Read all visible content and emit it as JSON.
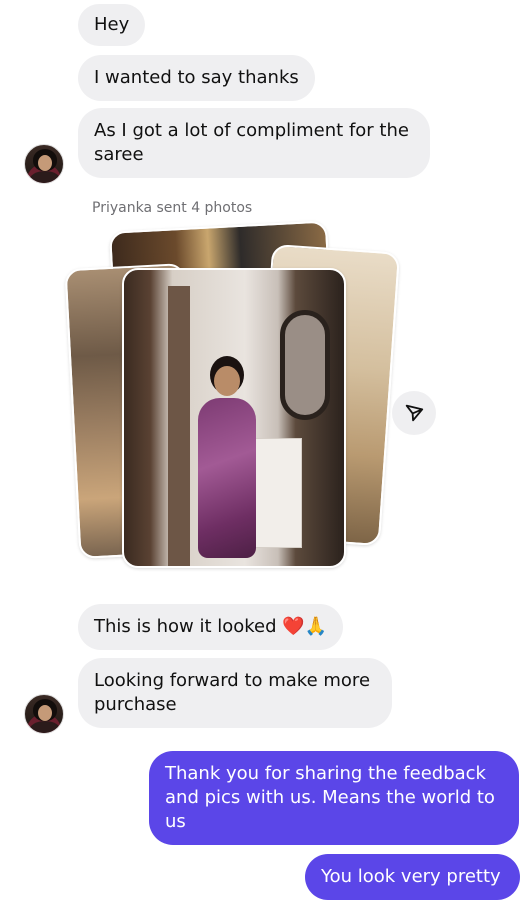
{
  "messages": {
    "m1": "Hey",
    "m2": "I wanted to say thanks",
    "m3": "As I got a lot of compliment for the\nsaree",
    "sent_photos": "Priyanka sent 4 photos",
    "m4": "This is how it looked ❤️🙏",
    "m5": "Looking forward to make more\npurchase",
    "m6": "Thank you for sharing the feedback\nand pics with us. Means the world to\nus",
    "m7": "You look very pretty"
  },
  "colors": {
    "incoming_bubble": "#efeff1",
    "outgoing_bubble": "#5b46e8"
  },
  "icons": {
    "share": "send-icon"
  }
}
